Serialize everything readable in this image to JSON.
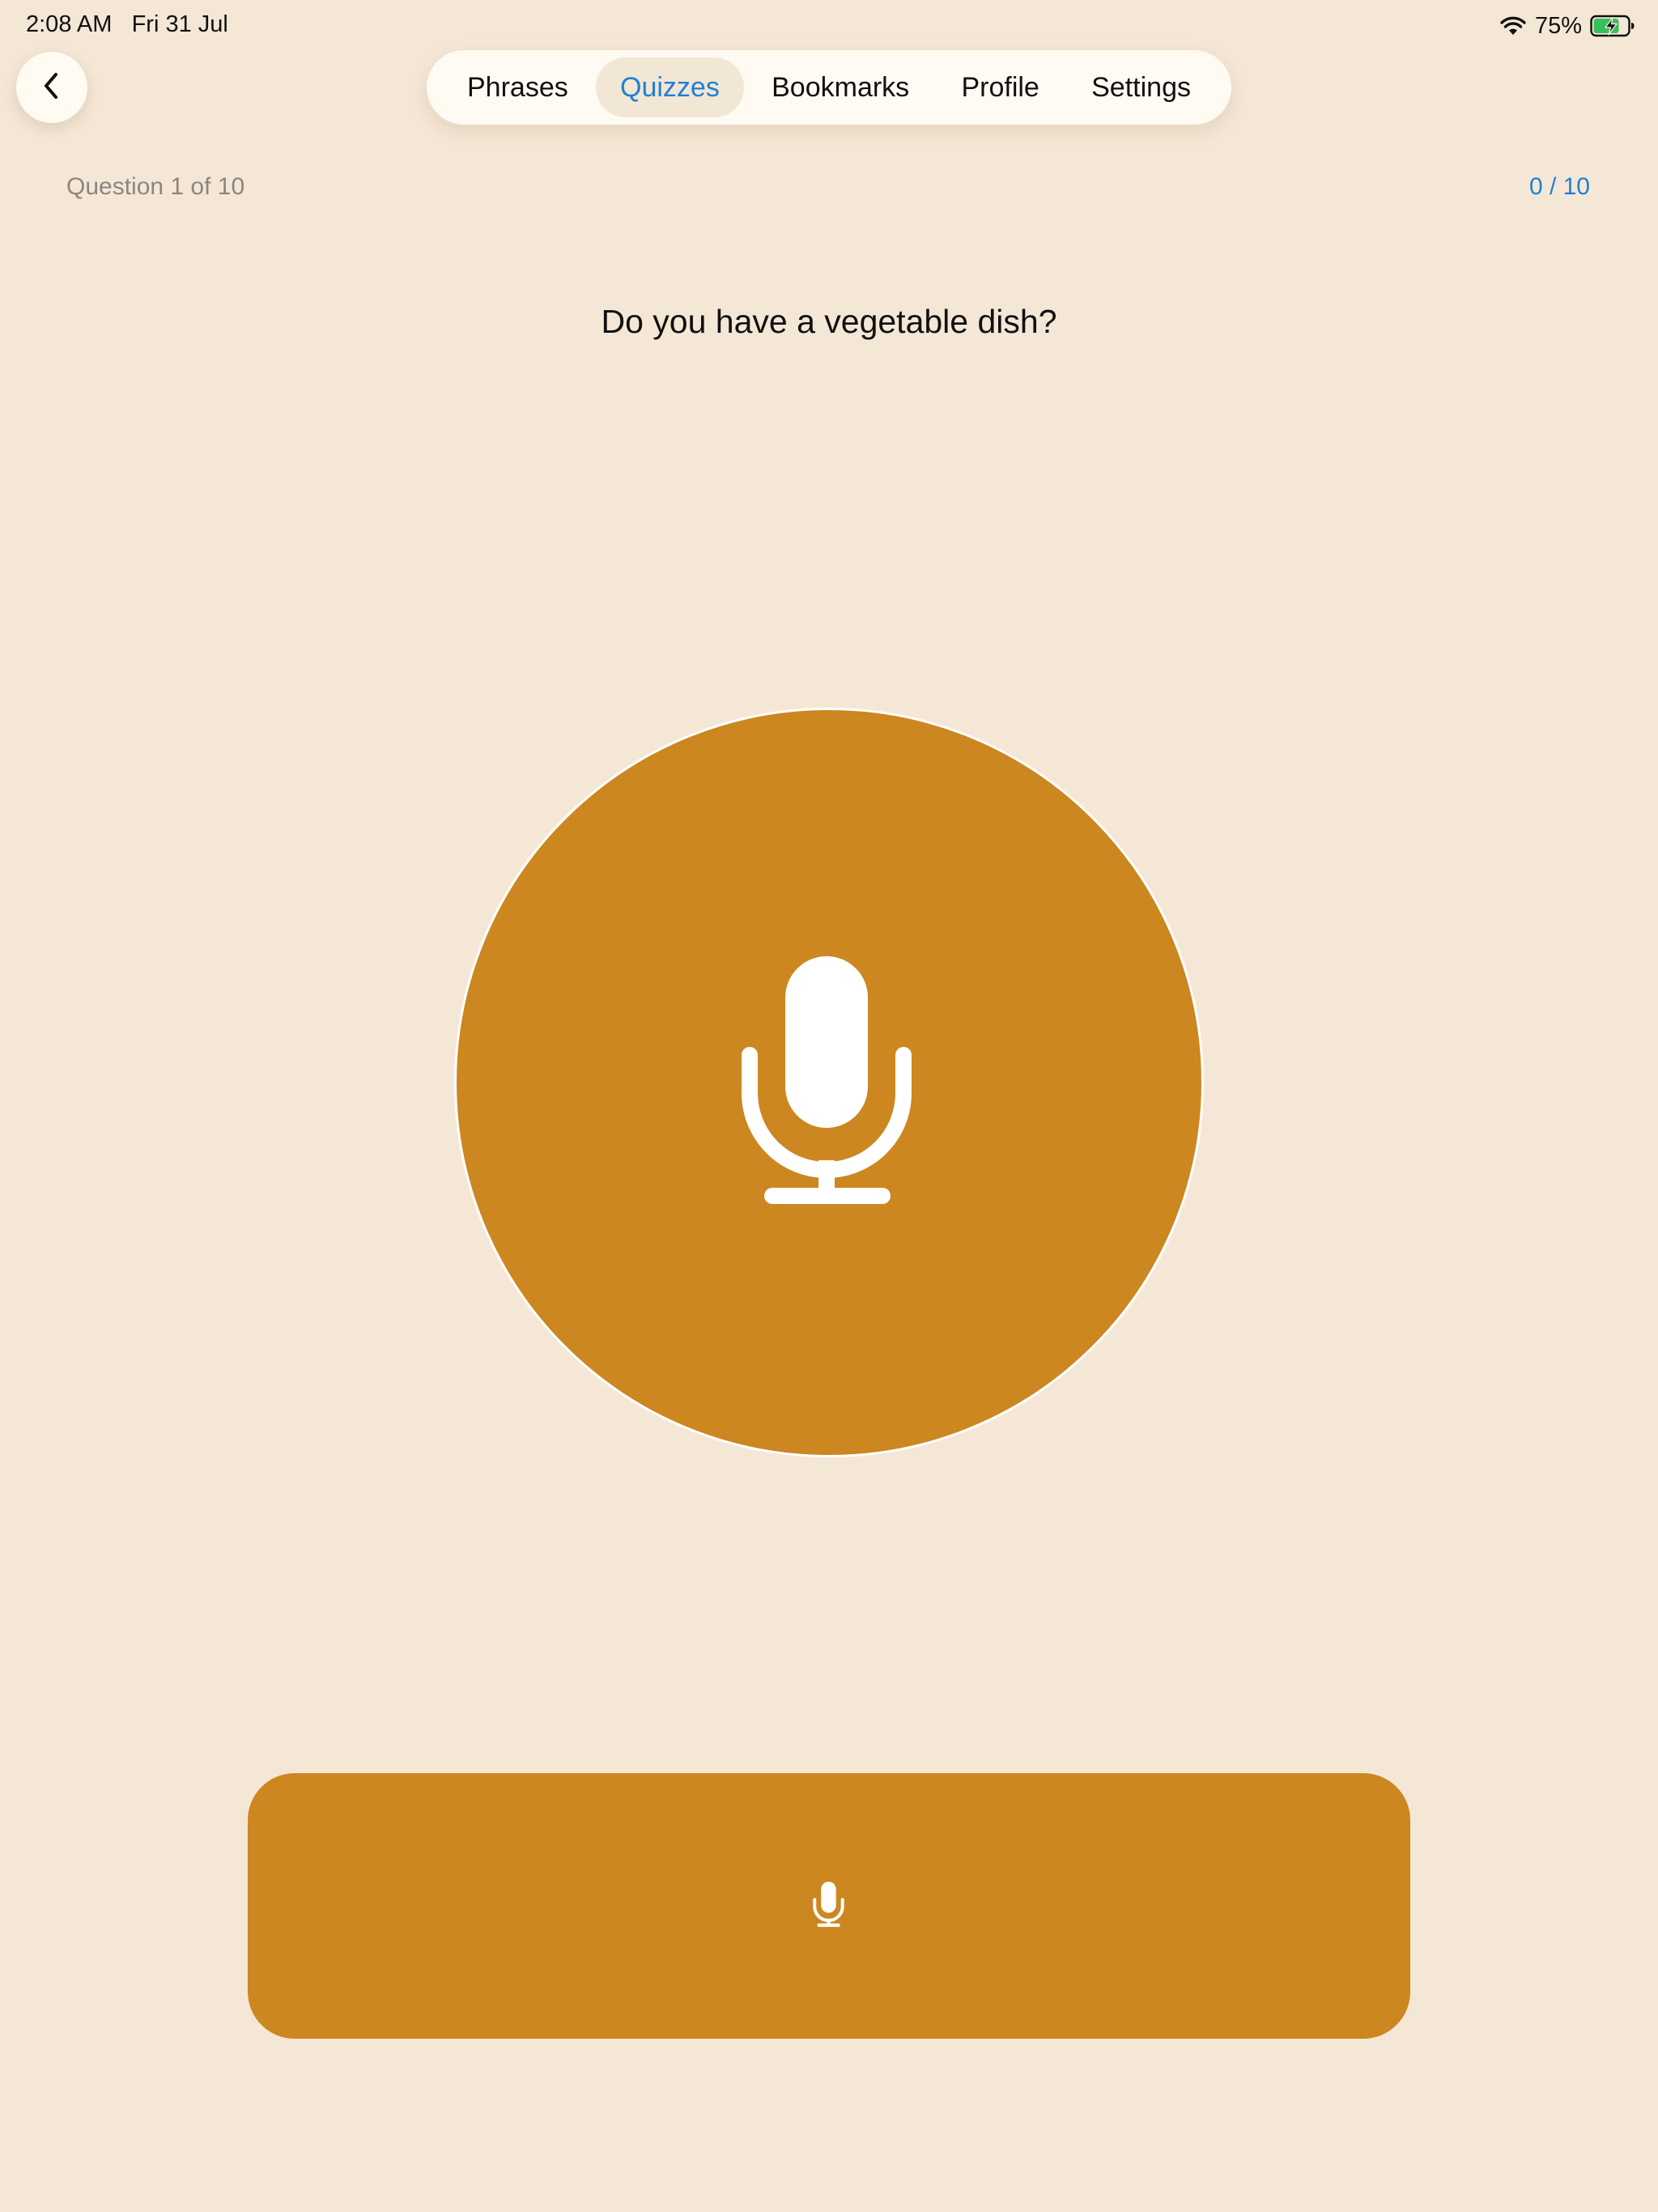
{
  "status_bar": {
    "time": "2:08 AM",
    "date": "Fri 31 Jul",
    "battery_percent": "75%",
    "wifi_icon": "wifi-icon",
    "battery_icon": "battery-charging-icon"
  },
  "nav": {
    "back_icon": "chevron-left-icon",
    "tabs": [
      {
        "label": "Phrases"
      },
      {
        "label": "Quizzes",
        "active": true
      },
      {
        "label": "Bookmarks"
      },
      {
        "label": "Profile"
      },
      {
        "label": "Settings"
      }
    ]
  },
  "quiz": {
    "progress_label": "Question 1 of 10",
    "score": "0 / 10",
    "prompt": "Do you have a vegetable dish?"
  },
  "controls": {
    "mic_icon": "microphone-icon"
  },
  "colors": {
    "background": "#f5e7d6",
    "accent": "#cc8720",
    "active_tab_text": "#1f7fd6",
    "secondary_text": "#8c8680",
    "surface": "#fffaf2"
  }
}
